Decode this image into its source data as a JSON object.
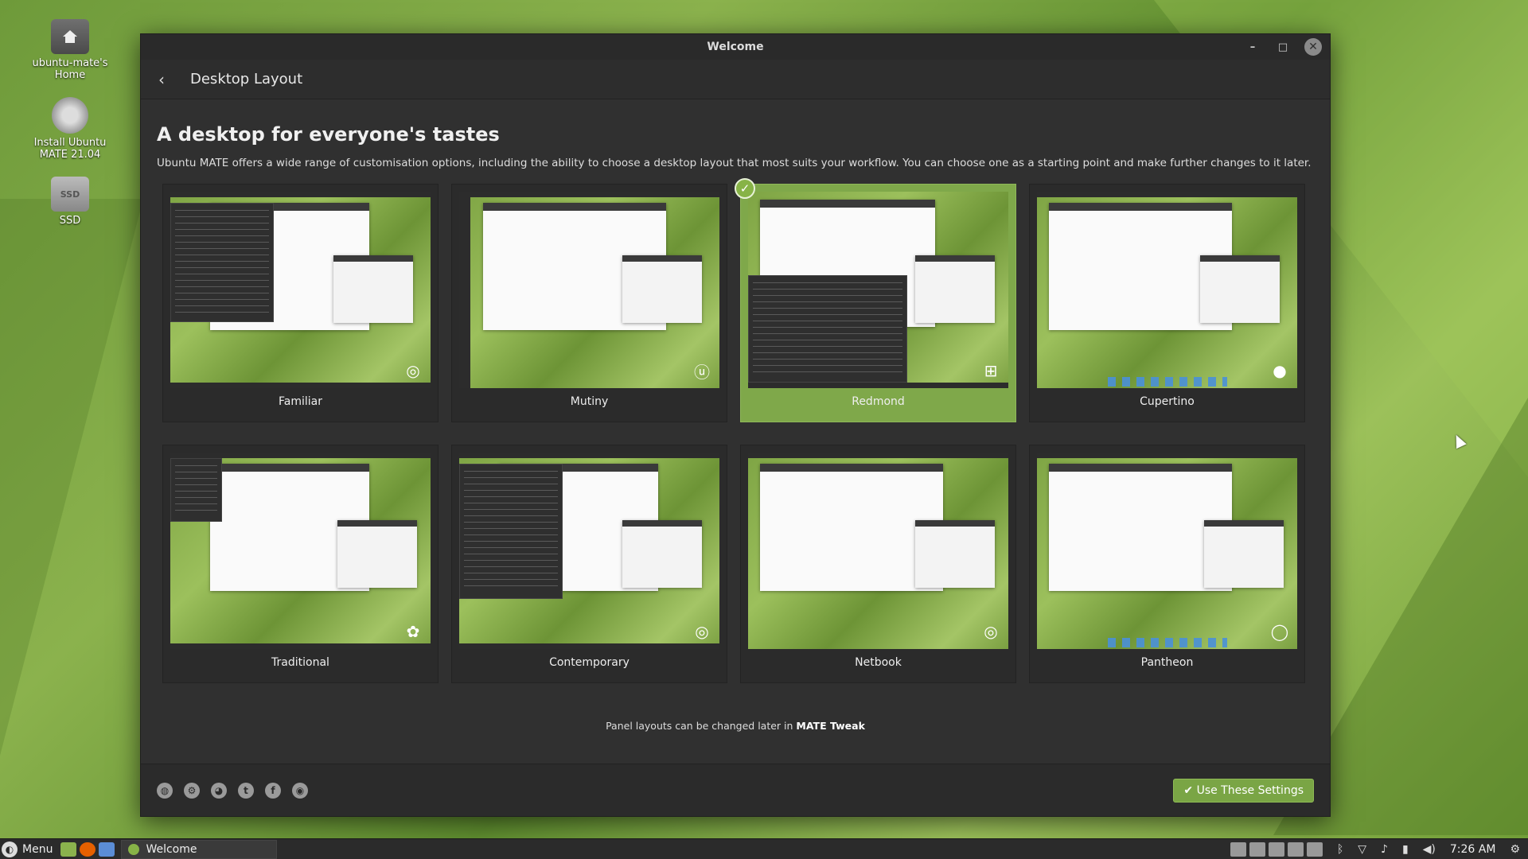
{
  "desktop": {
    "icons": [
      {
        "label_line1": "ubuntu-mate's",
        "label_line2": "Home"
      },
      {
        "label_line1": "Install Ubuntu",
        "label_line2": "MATE 21.04"
      },
      {
        "label_line1": "SSD",
        "label_line2": "",
        "badge": "SSD"
      }
    ]
  },
  "window": {
    "title": "Welcome",
    "controls": {
      "minimize": "–",
      "maximize": "□",
      "close": "✕"
    }
  },
  "header": {
    "back_glyph": "‹",
    "title": "Desktop Layout"
  },
  "main": {
    "heading": "A desktop for everyone's tastes",
    "description": "Ubuntu MATE offers a wide range of customisation options, including the ability to choose a desktop layout that most suits your workflow. You can choose one as a starting point and make further changes to it later.",
    "layouts": [
      {
        "name": "Familiar"
      },
      {
        "name": "Mutiny"
      },
      {
        "name": "Redmond",
        "selected": true
      },
      {
        "name": "Cupertino"
      },
      {
        "name": "Traditional"
      },
      {
        "name": "Contemporary"
      },
      {
        "name": "Netbook"
      },
      {
        "name": "Pantheon"
      }
    ],
    "footnote_prefix": "Panel layouts can be changed later in ",
    "footnote_app": "MATE Tweak"
  },
  "footer": {
    "socials": [
      "web-icon",
      "ubuntu-icon",
      "github-icon",
      "twitter-icon",
      "facebook-icon",
      "discord-icon"
    ],
    "use_button": "✔ Use These Settings"
  },
  "taskbar": {
    "menu_label": "Menu",
    "task_label": "Welcome",
    "clock": "7:26 AM"
  },
  "colors": {
    "accent": "#87b347",
    "window_bg": "#303030"
  }
}
